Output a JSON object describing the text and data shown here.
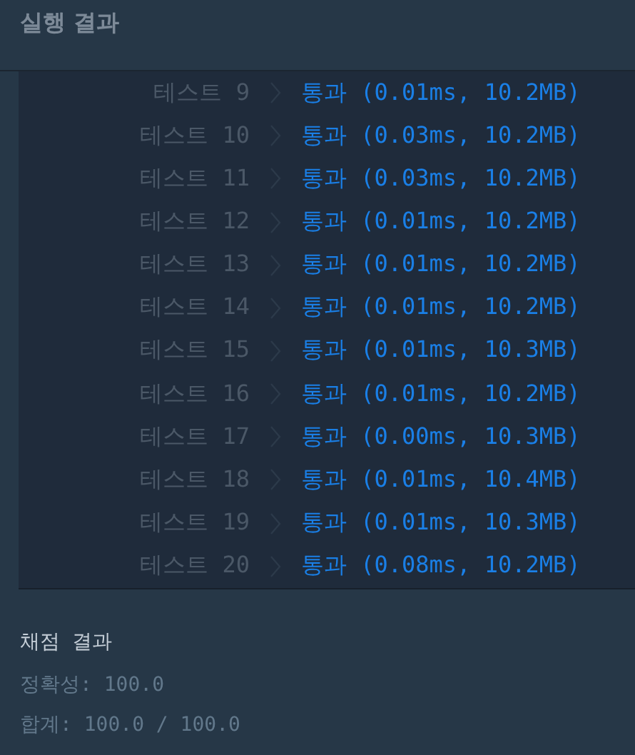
{
  "header": {
    "title": "실행 결과"
  },
  "tests": [
    {
      "label": "테스트 9",
      "result": "통과 (0.01ms, 10.2MB)",
      "kind": "pass"
    },
    {
      "label": "테스트 10",
      "result": "통과 (0.03ms, 10.2MB)",
      "kind": "pass"
    },
    {
      "label": "테스트 11",
      "result": "통과 (0.03ms, 10.2MB)",
      "kind": "pass"
    },
    {
      "label": "테스트 12",
      "result": "통과 (0.01ms, 10.2MB)",
      "kind": "pass"
    },
    {
      "label": "테스트 13",
      "result": "통과 (0.01ms, 10.2MB)",
      "kind": "pass"
    },
    {
      "label": "테스트 14",
      "result": "통과 (0.01ms, 10.2MB)",
      "kind": "pass"
    },
    {
      "label": "테스트 15",
      "result": "통과 (0.01ms, 10.3MB)",
      "kind": "pass"
    },
    {
      "label": "테스트 16",
      "result": "통과 (0.01ms, 10.2MB)",
      "kind": "pass"
    },
    {
      "label": "테스트 17",
      "result": "통과 (0.00ms, 10.3MB)",
      "kind": "pass"
    },
    {
      "label": "테스트 18",
      "result": "통과 (0.01ms, 10.4MB)",
      "kind": "pass"
    },
    {
      "label": "테스트 19",
      "result": "통과 (0.01ms, 10.3MB)",
      "kind": "pass"
    },
    {
      "label": "테스트 20",
      "result": "통과 (0.08ms, 10.2MB)",
      "kind": "pass"
    }
  ],
  "grading": {
    "title": "채점 결과",
    "lines": [
      "정확성: 100.0",
      "합계: 100.0 / 100.0"
    ]
  }
}
